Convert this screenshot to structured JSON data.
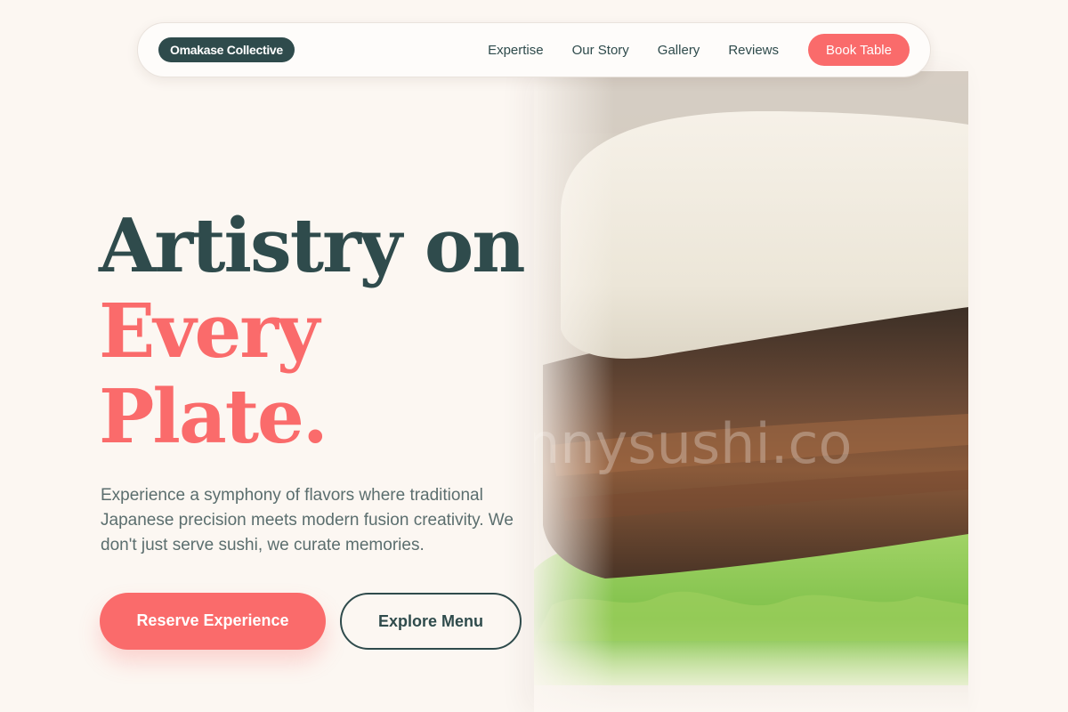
{
  "brand": {
    "name": "Omakase Collective"
  },
  "nav": {
    "links": [
      "Expertise",
      "Our Story",
      "Gallery",
      "Reviews"
    ],
    "cta_label": "Book Table"
  },
  "hero": {
    "headline_line1": "Artistry on",
    "headline_line2": "Every",
    "headline_line3": "Plate.",
    "description": "Experience a symphony of flavors where traditional Japanese precision meets modern fusion creativity. We don't just serve sushi, we curate memories.",
    "primary_cta": "Reserve Experience",
    "secondary_cta": "Explore Menu",
    "image_watermark": "nnysushi.co"
  },
  "colors": {
    "dark_teal": "#2f4b4c",
    "coral": "#fa6b6b",
    "background": "#fcf7f2"
  }
}
